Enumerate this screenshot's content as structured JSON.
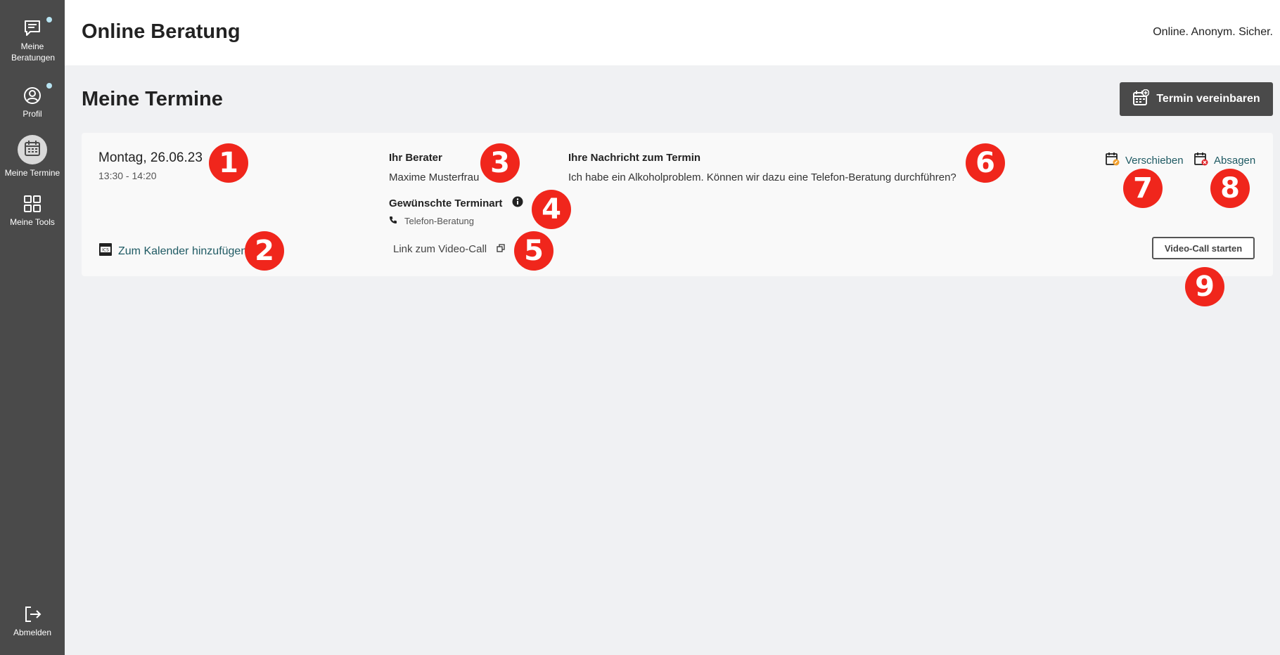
{
  "sidebar": {
    "items": [
      {
        "label": "Meine Beratungen",
        "icon": "chat-icon",
        "has_dot": true
      },
      {
        "label": "Profil",
        "icon": "profile-icon",
        "has_dot": true
      },
      {
        "label": "Meine Termine",
        "icon": "calendar-icon",
        "active": true
      },
      {
        "label": "Meine Tools",
        "icon": "grid-icon"
      }
    ],
    "logout": {
      "label": "Abmelden",
      "icon": "logout-icon"
    }
  },
  "header": {
    "title": "Online Beratung",
    "tagline": "Online. Anonym. Sicher."
  },
  "main": {
    "title": "Meine Termine",
    "new_appointment_button": "Termin vereinbaren",
    "appointment": {
      "date": "Montag, 26.06.23",
      "time": "13:30 - 14:20",
      "add_to_calendar": "Zum Kalender hinzufügen",
      "advisor_label": "Ihr Berater",
      "advisor_name": "Maxime Musterfrau",
      "type_label": "Gewünschte Terminart",
      "type_value": "Telefon-Beratung",
      "video_link": "Link zum Video-Call",
      "message_label": "Ihre Nachricht zum Termin",
      "message_text": "Ich habe ein Alkoholproblem. Können wir dazu eine Telefon-Beratung durchführen?",
      "reschedule": "Verschieben",
      "cancel": "Absagen",
      "start_video_call": "Video-Call starten"
    }
  },
  "markers": [
    "1",
    "2",
    "3",
    "4",
    "5",
    "6",
    "7",
    "8",
    "9"
  ],
  "colors": {
    "sidebar_bg": "#4a4a4a",
    "content_bg": "#f0f1f3",
    "link": "#1f5a63",
    "marker": "#f0261c",
    "notification_dot": "#b7e4f2"
  }
}
